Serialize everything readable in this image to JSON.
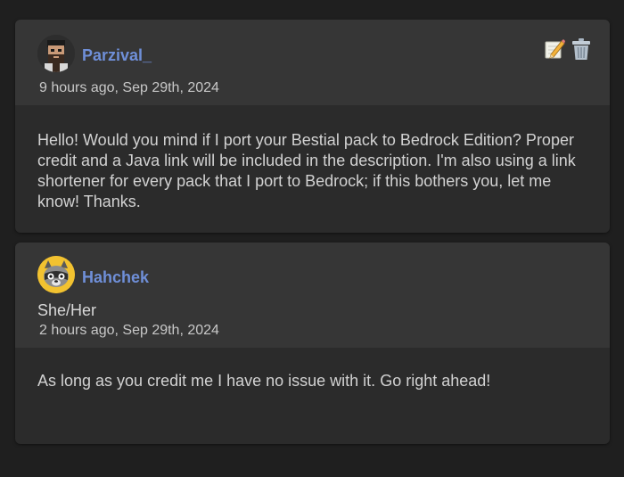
{
  "comments": [
    {
      "username": "Parzival_",
      "timestamp": "9 hours ago, Sep 29th, 2024",
      "body": "Hello! Would you mind if I port your Bestial pack to Bedrock Edition? Proper credit and a Java link will be included in the description. I'm also using a link shortener for every pack that I port to Bedrock; if this bothers you, let me know! Thanks.",
      "avatar_icon": "bearded-man-avatar",
      "actions": [
        "edit-icon",
        "trash-icon"
      ]
    },
    {
      "username": "Hahchek",
      "pronouns": "She/Her",
      "timestamp": "2 hours ago, Sep 29th, 2024",
      "body": "As long as you credit me I have no issue with it. Go right ahead!",
      "avatar_icon": "raccoon-avatar"
    }
  ],
  "colors": {
    "background": "#1f1f1f",
    "card": "#2b2b2b",
    "card_header": "#363636",
    "username": "#6f8fd8",
    "text": "#d2d2d2"
  }
}
